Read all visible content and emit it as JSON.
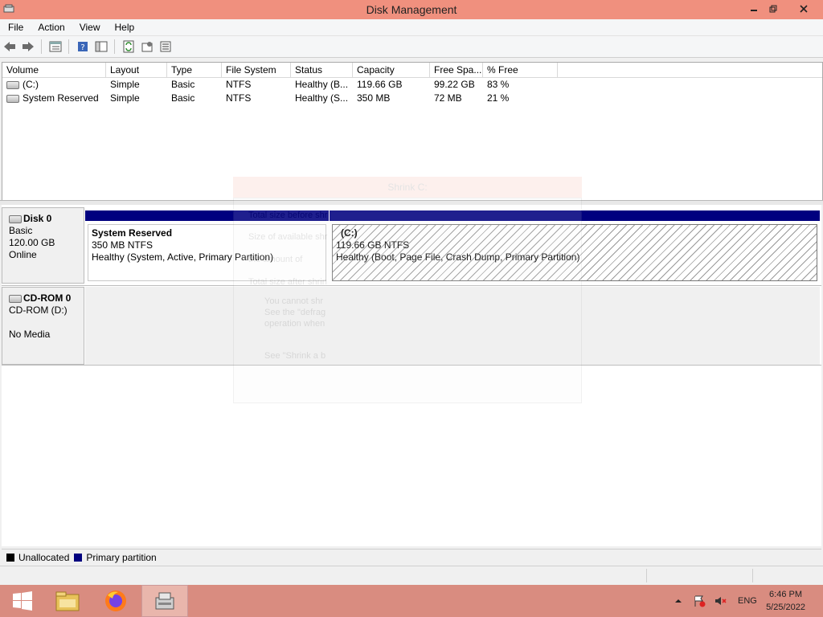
{
  "window": {
    "title": "Disk Management"
  },
  "menu": [
    "File",
    "Action",
    "View",
    "Help"
  ],
  "toolbar": {
    "buttons": [
      "back-icon",
      "forward-icon",
      "properties-list-icon",
      "help-icon",
      "console-icon",
      "refresh-icon",
      "settings-icon",
      "disk-properties-icon"
    ]
  },
  "volume_table": {
    "columns": [
      "Volume",
      "Layout",
      "Type",
      "File System",
      "Status",
      "Capacity",
      "Free Spa...",
      "% Free"
    ],
    "rows": [
      {
        "volume": "(C:)",
        "layout": "Simple",
        "type": "Basic",
        "fs": "NTFS",
        "status": "Healthy (B...",
        "capacity": "119.66 GB",
        "free": "99.22 GB",
        "pct": "83 %"
      },
      {
        "volume": "System Reserved",
        "layout": "Simple",
        "type": "Basic",
        "fs": "NTFS",
        "status": "Healthy (S...",
        "capacity": "350 MB",
        "free": "72 MB",
        "pct": "21 %"
      }
    ]
  },
  "disks": [
    {
      "name": "Disk 0",
      "kind": "Basic",
      "size": "120.00 GB",
      "state": "Online",
      "partitions": [
        {
          "name": "System Reserved",
          "size": "350 MB NTFS",
          "status": "Healthy (System, Active, Primary Partition)"
        },
        {
          "name": "(C:)",
          "size": "119.66 GB NTFS",
          "status": "Healthy (Boot, Page File, Crash Dump, Primary Partition)"
        }
      ]
    },
    {
      "name": "CD-ROM 0",
      "kind": "CD-ROM (D:)",
      "media": "No Media"
    }
  ],
  "ghost_dialog": {
    "title": "Shrink C:",
    "lines": [
      "Total size before shr",
      "Size of available shr",
      "the amount of",
      "Total size after shrin",
      "You cannot shr",
      "See the \"defrag",
      "operation when",
      "See \"Shrink a b"
    ]
  },
  "legend": [
    {
      "label": "Unallocated",
      "color": "#000000"
    },
    {
      "label": "Primary partition",
      "color": "#00007f"
    }
  ],
  "taskbar": {
    "apps": [
      "windows-start-icon",
      "file-explorer-icon",
      "firefox-icon",
      "disk-management-icon"
    ],
    "tray": {
      "lang": "ENG",
      "time": "6:46 PM",
      "date": "5/25/2022"
    }
  }
}
